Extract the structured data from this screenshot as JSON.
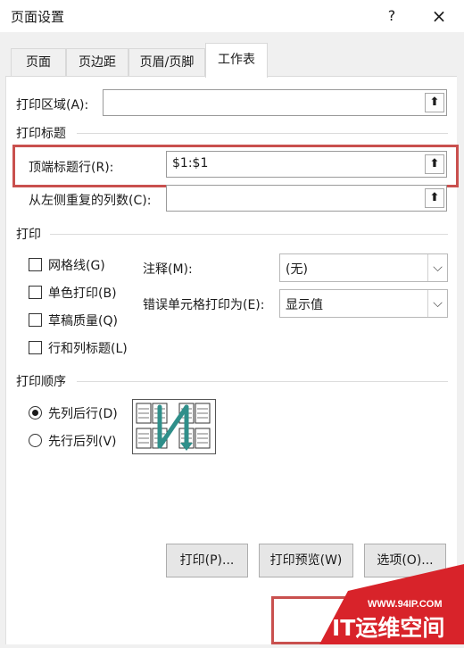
{
  "dialog": {
    "title": "页面设置",
    "help": "?",
    "close": "×"
  },
  "tabs": [
    "页面",
    "页边距",
    "页眉/页脚",
    "工作表"
  ],
  "print_area": {
    "label": "打印区域(A):",
    "value": ""
  },
  "print_titles": {
    "section": "打印标题",
    "top_rows_label": "顶端标题行(R):",
    "top_rows_value": "$1:$1",
    "left_cols_label": "从左侧重复的列数(C):",
    "left_cols_value": ""
  },
  "print": {
    "section": "打印",
    "gridlines": "网格线(G)",
    "black_white": "单色打印(B)",
    "draft": "草稿质量(Q)",
    "headings": "行和列标题(L)",
    "comments_label": "注释(M):",
    "comments_value": "(无)",
    "errors_label": "错误单元格打印为(E):",
    "errors_value": "显示值"
  },
  "page_order": {
    "section": "打印顺序",
    "down_then_over": "先列后行(D)",
    "over_then_down": "先行后列(V)",
    "selected": "down_then_over"
  },
  "buttons": {
    "print": "打印(P)...",
    "preview": "打印预览(W)",
    "options": "选项(O)..."
  },
  "watermark": {
    "url": "WWW.94IP.COM",
    "brand": "IT运维空间"
  },
  "colors": {
    "highlight": "#c9504e",
    "watermark_red": "#d8232a",
    "accent_teal": "#2f8f8a"
  }
}
